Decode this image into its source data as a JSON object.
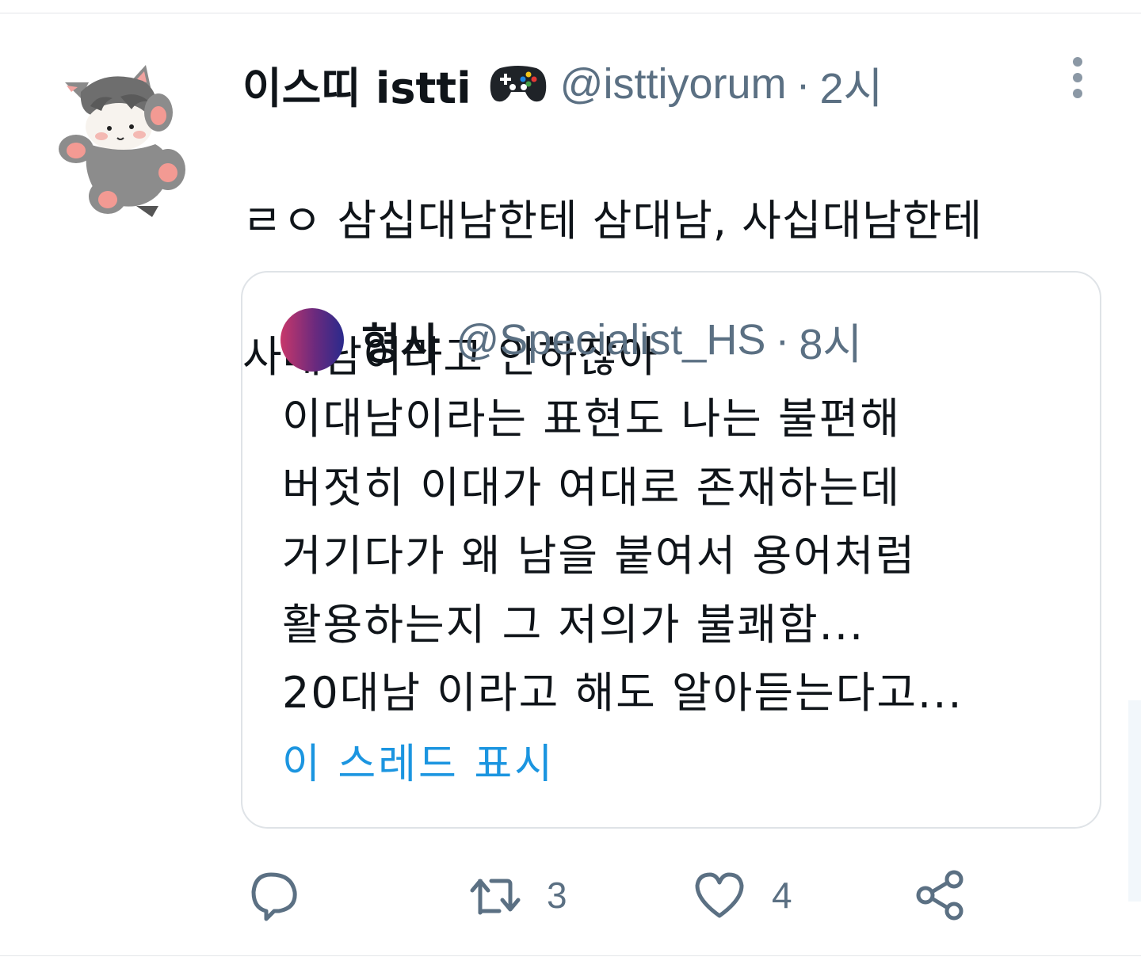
{
  "tweet": {
    "author": {
      "display_name": "이스띠 istti",
      "handle": "@isttiyorum",
      "badge_icon": "gamepad-icon",
      "avatar_icon": "cat-avatar-icon"
    },
    "separator": "·",
    "time": "2시",
    "text_lines": [
      "ㄹㅇ 삼십대남한테 삼대남, 사십대남한테",
      "사대남이라고 안하잖아"
    ],
    "quote": {
      "author": {
        "display_name": "형사",
        "handle": "@Specialist_HS"
      },
      "separator": "·",
      "time": "8시",
      "text_lines": [
        "이대남이라는 표현도 나는 불편해",
        "버젓히 이대가 여대로 존재하는데",
        "거기다가 왜 남을 붙여서 용어처럼",
        "활용하는지 그 저의가 불쾌함...",
        "20대남 이라고 해도 알아듣는다고..."
      ],
      "show_thread_label": "이 스레드 표시"
    },
    "actions": {
      "reply": {
        "icon": "reply-icon"
      },
      "retweet": {
        "icon": "retweet-icon",
        "count": "3"
      },
      "like": {
        "icon": "heart-icon",
        "count": "4"
      },
      "share": {
        "icon": "share-icon"
      }
    }
  },
  "colors": {
    "text": "#0f1419",
    "secondary": "#5b7083",
    "link": "#1b95e0",
    "border": "#dfe3e7"
  }
}
